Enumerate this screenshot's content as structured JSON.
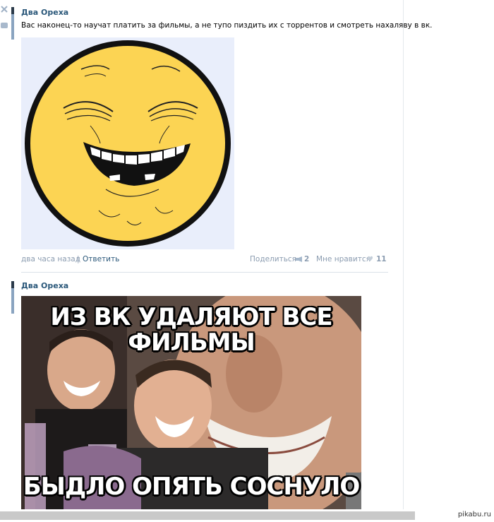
{
  "posts": [
    {
      "author": "Два Ореха",
      "text": "Вас наконец-то научат платить за фильмы, а не тупо пиздить их с торрентов и смотреть нахаляву в вк.",
      "time": "два часа назад",
      "separator": "|",
      "reply_label": "Ответить",
      "share_label": "Поделиться",
      "share_count": "2",
      "like_label": "Мне нравится",
      "like_count": "11"
    },
    {
      "author": "Два Ореха",
      "meme_top": "ИЗ ВК УДАЛЯЮТ ВСЕ ФИЛЬМЫ",
      "meme_bottom": "БЫДЛО ОПЯТЬ СОСНУЛО"
    }
  ],
  "watermark": "pikabu.ru",
  "icons": {
    "close": "close-icon",
    "comment": "comment-icon",
    "share": "megaphone-icon",
    "like": "heart-icon"
  },
  "colors": {
    "link": "#2b587a",
    "meta": "#8b9cb0",
    "smiley": "#fcd453"
  }
}
